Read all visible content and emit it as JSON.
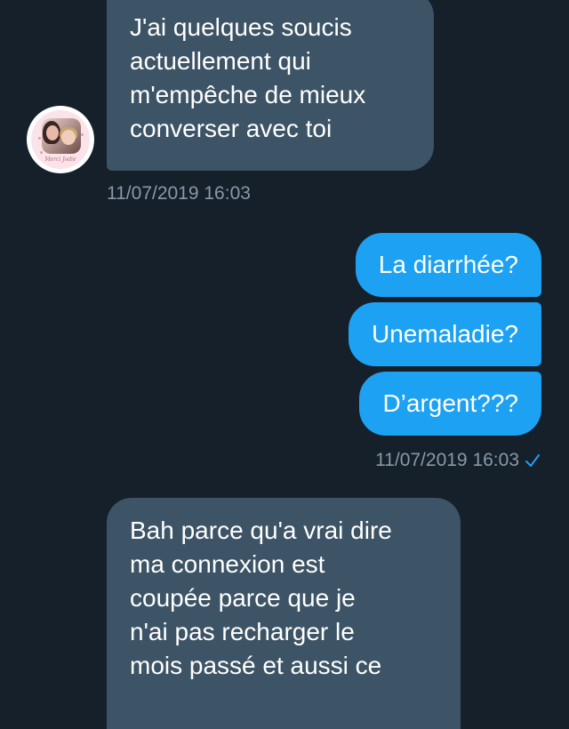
{
  "conversation": {
    "received_1": {
      "text": "J'ai quelques soucis\nactuellement qui\nm'empêche de mieux\nconverser avec toi",
      "timestamp": "11/07/2019 16:03"
    },
    "avatar": {
      "caption": "Merci Jodie"
    },
    "sent": {
      "messages": [
        "La diarrhée?",
        "Unemaladie?",
        "D’argent???"
      ],
      "timestamp": "11/07/2019 16:03",
      "read_icon": "checkmark-icon"
    },
    "received_2": {
      "text": "Bah parce qu'a vrai dire\nma connexion est\ncoupée parce que je\nn'ai pas recharger le\nmois passé et aussi ce"
    }
  },
  "colors": {
    "background": "#15202b",
    "received_bubble": "#3d5466",
    "sent_bubble": "#1da1f2",
    "timestamp": "#8899a6",
    "checkmark": "#1da1f2"
  }
}
